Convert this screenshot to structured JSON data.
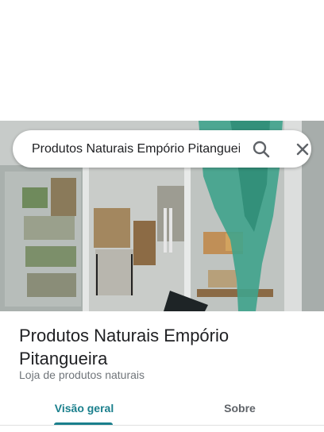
{
  "search": {
    "query": "Produtos Naturais Empório Pitangueira"
  },
  "icons": {
    "search": "search-icon",
    "close": "close-icon"
  },
  "place": {
    "name": "Produtos Naturais Empório Pitangueira",
    "category": "Loja de produtos naturais"
  },
  "tabs": [
    {
      "label": "Visão geral",
      "selected": true
    },
    {
      "label": "Sobre",
      "selected": false
    }
  ],
  "colors": {
    "accent": "#1a7f8c",
    "text_primary": "#202124",
    "text_secondary": "#70757a"
  }
}
